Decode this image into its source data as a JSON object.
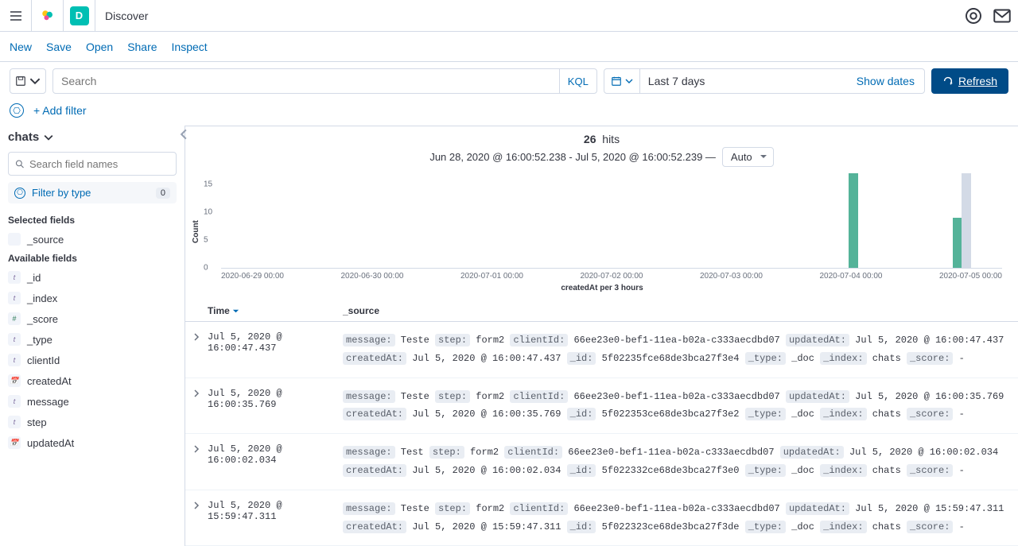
{
  "header": {
    "app_letter": "D",
    "breadcrumb": "Discover"
  },
  "menubar": {
    "new": "New",
    "save": "Save",
    "open": "Open",
    "share": "Share",
    "inspect": "Inspect"
  },
  "query": {
    "search_placeholder": "Search",
    "kql": "KQL",
    "date_range": "Last 7 days",
    "show_dates": "Show dates",
    "refresh": "Refresh"
  },
  "filters": {
    "add_filter": "+ Add filter"
  },
  "sidebar": {
    "index": "chats",
    "search_placeholder": "Search field names",
    "filter_type": "Filter by type",
    "filter_count": "0",
    "selected_title": "Selected fields",
    "available_title": "Available fields",
    "selected": [
      {
        "icon": "</>",
        "name": "_source",
        "cls": "src"
      }
    ],
    "available": [
      {
        "icon": "t",
        "name": "_id",
        "cls": ""
      },
      {
        "icon": "t",
        "name": "_index",
        "cls": ""
      },
      {
        "icon": "#",
        "name": "_score",
        "cls": "num"
      },
      {
        "icon": "t",
        "name": "_type",
        "cls": ""
      },
      {
        "icon": "t",
        "name": "clientId",
        "cls": ""
      },
      {
        "icon": "📅",
        "name": "createdAt",
        "cls": "date"
      },
      {
        "icon": "t",
        "name": "message",
        "cls": ""
      },
      {
        "icon": "t",
        "name": "step",
        "cls": ""
      },
      {
        "icon": "📅",
        "name": "updatedAt",
        "cls": "date"
      }
    ]
  },
  "hits": {
    "count": "26",
    "label": "hits",
    "range": "Jun 28, 2020 @ 16:00:52.238 - Jul 5, 2020 @ 16:00:52.239 —",
    "interval": "Auto"
  },
  "chart_data": {
    "type": "bar",
    "ylabel": "Count",
    "xlabel": "createdAt per 3 hours",
    "ylim": [
      0,
      17
    ],
    "yticks": [
      0,
      5,
      10,
      15
    ],
    "xticks": [
      "2020-06-29 00:00",
      "2020-06-30 00:00",
      "2020-07-01 00:00",
      "2020-07-02 00:00",
      "2020-07-03 00:00",
      "2020-07-04 00:00",
      "2020-07-05 00:00"
    ],
    "bars": [
      {
        "pos_pct": 80.3,
        "value": 17,
        "color": "green"
      },
      {
        "pos_pct": 93.7,
        "value": 9,
        "color": "green"
      },
      {
        "pos_pct": 94.8,
        "value": 17,
        "color": "grey"
      }
    ]
  },
  "table": {
    "time_col": "Time",
    "source_col": "_source",
    "rows": [
      {
        "time": "Jul 5, 2020 @ 16:00:47.437",
        "fields": {
          "message": "Teste",
          "step": "form2",
          "clientId": "66ee23e0-bef1-11ea-b02a-c333aecdbd07",
          "updatedAt": "Jul 5, 2020 @ 16:00:47.437",
          "createdAt": "Jul 5, 2020 @ 16:00:47.437",
          "_id": "5f02235fce68de3bca27f3e4",
          "_type": "_doc",
          "_index": "chats",
          "_score": "-"
        }
      },
      {
        "time": "Jul 5, 2020 @ 16:00:35.769",
        "fields": {
          "message": "Teste",
          "step": "form2",
          "clientId": "66ee23e0-bef1-11ea-b02a-c333aecdbd07",
          "updatedAt": "Jul 5, 2020 @ 16:00:35.769",
          "createdAt": "Jul 5, 2020 @ 16:00:35.769",
          "_id": "5f022353ce68de3bca27f3e2",
          "_type": "_doc",
          "_index": "chats",
          "_score": "-"
        }
      },
      {
        "time": "Jul 5, 2020 @ 16:00:02.034",
        "fields": {
          "message": "Test",
          "step": "form2",
          "clientId": "66ee23e0-bef1-11ea-b02a-c333aecdbd07",
          "updatedAt": "Jul 5, 2020 @ 16:00:02.034",
          "createdAt": "Jul 5, 2020 @ 16:00:02.034",
          "_id": "5f022332ce68de3bca27f3e0",
          "_type": "_doc",
          "_index": "chats",
          "_score": "-"
        }
      },
      {
        "time": "Jul 5, 2020 @ 15:59:47.311",
        "fields": {
          "message": "Teste",
          "step": "form2",
          "clientId": "66ee23e0-bef1-11ea-b02a-c333aecdbd07",
          "updatedAt": "Jul 5, 2020 @ 15:59:47.311",
          "createdAt": "Jul 5, 2020 @ 15:59:47.311",
          "_id": "5f022323ce68de3bca27f3de",
          "_type": "_doc",
          "_index": "chats",
          "_score": "-"
        }
      }
    ]
  }
}
